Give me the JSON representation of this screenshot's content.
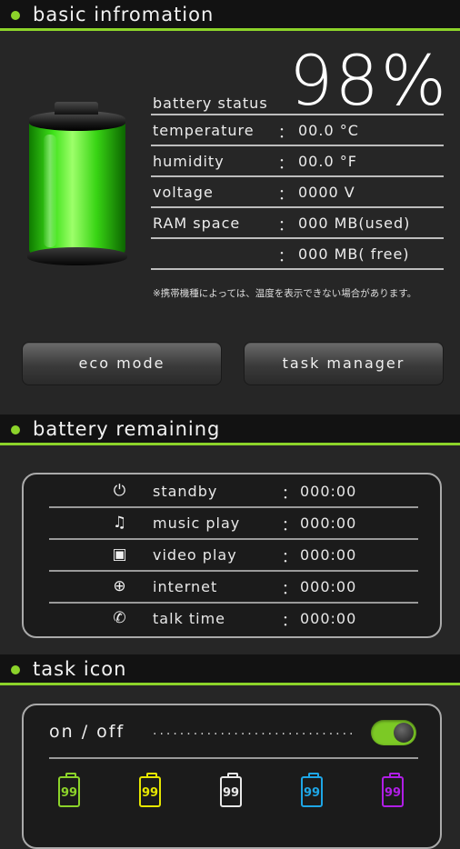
{
  "sections": {
    "basic": "basic infromation",
    "remaining": "battery remaining",
    "task": "task icon"
  },
  "battery_percent": "98%",
  "battery_level": 0.98,
  "info": [
    {
      "label": "battery status",
      "colon": "",
      "value": ""
    },
    {
      "label": "temperature",
      "colon": "：",
      "value": "00.0 °C"
    },
    {
      "label": "humidity",
      "colon": "：",
      "value": "00.0 °F"
    },
    {
      "label": "voltage",
      "colon": "：",
      "value": "0000 V"
    },
    {
      "label": "RAM space",
      "colon": "：",
      "value": "000 MB(used)"
    },
    {
      "label": "",
      "colon": "：",
      "value": "000 MB( free)"
    }
  ],
  "note": "※携帯機種によっては、温度を表示できない場合があります。",
  "buttons": {
    "eco": "eco mode",
    "task": "task manager"
  },
  "remaining": [
    {
      "icon": "power-icon",
      "glyph": "⏻",
      "label": "standby",
      "value": "000:00"
    },
    {
      "icon": "music-note-icon",
      "glyph": "♫",
      "label": "music play",
      "value": "000:00"
    },
    {
      "icon": "video-camera-icon",
      "glyph": "▣",
      "label": "video play",
      "value": "000:00"
    },
    {
      "icon": "globe-icon",
      "glyph": "⊕",
      "label": "internet",
      "value": "000:00"
    },
    {
      "icon": "phone-icon",
      "glyph": "✆",
      "label": "talk time",
      "value": "000:00"
    }
  ],
  "colon": "：",
  "task_icon": {
    "toggle_label": "on / off",
    "toggle_on": true,
    "dots": "..............................",
    "icons": [
      {
        "text": "99",
        "color": "#8cd32a"
      },
      {
        "text": "99",
        "color": "#e6e600"
      },
      {
        "text": "99",
        "color": "#e8e8e8"
      },
      {
        "text": "99",
        "color": "#1ea6e6"
      },
      {
        "text": "99",
        "color": "#b01ee6"
      }
    ]
  },
  "accent": "#8cd32a"
}
